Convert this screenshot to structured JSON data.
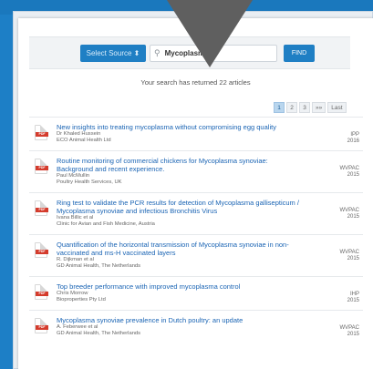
{
  "search": {
    "source_button": "Select Source ⬍",
    "query": "Mycoplasma",
    "find_button": "FIND",
    "result_count": "Your search has returned 22 articles"
  },
  "pager": [
    "1",
    "2",
    "3",
    "»»",
    "Last"
  ],
  "results": [
    {
      "title": "New insights into treating mycoplasma without compromising egg quality",
      "author": "Dr Khaled Hussein",
      "org": "ECO Animal Health Ltd",
      "source": "IPP",
      "year": "2016"
    },
    {
      "title": "Routine monitoring of commercial chickens for Mycoplasma synoviae: Background and recent experience.",
      "author": "Paul McMullin",
      "org": "Poultry Health Services, UK",
      "source": "WVPAC",
      "year": "2015"
    },
    {
      "title": "Ring test to validate the PCR results for detection of Mycoplasma gallisepticum / Mycoplasma synoviae and infectious Bronchitis Virus",
      "author": "Ivana Billic et al",
      "org": "Clinic for Avian and Fish Medicine, Austria",
      "source": "WVPAC",
      "year": "2015"
    },
    {
      "title": "Quantification of the horizontal transmission of Mycoplasma synoviae in non-vaccinated and ms-H vaccinated layers",
      "author": "R. Dijkman et al",
      "org": "GD Animal Health, The Netherlands",
      "source": "WVPAC",
      "year": "2015"
    },
    {
      "title": "Top breeder performance with improved mycoplasma control",
      "author": "Chris Morrow",
      "org": "Bioproperties Pty Ltd",
      "source": "IHP",
      "year": "2015"
    },
    {
      "title": "Mycoplasma synoviae prevalence in Dutch poultry: an update",
      "author": "A. Feberwee et al",
      "org": "GD Animal Health, The Netherlands",
      "source": "WVPAC",
      "year": "2015"
    }
  ]
}
